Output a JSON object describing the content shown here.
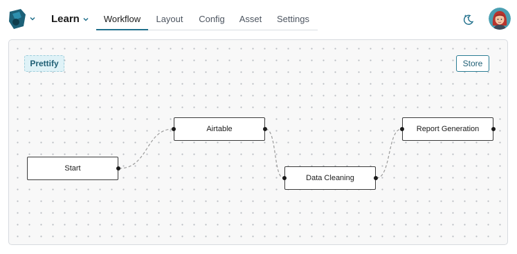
{
  "header": {
    "project_name": "Learn",
    "tabs": [
      {
        "label": "Workflow",
        "active": true
      },
      {
        "label": "Layout",
        "active": false
      },
      {
        "label": "Config",
        "active": false
      },
      {
        "label": "Asset",
        "active": false
      },
      {
        "label": "Settings",
        "active": false
      }
    ],
    "icons": {
      "logo": "app-logo-icon",
      "theme": "moon-sparkle-icon",
      "avatar": "user-avatar"
    }
  },
  "canvas": {
    "prettify_label": "Prettify",
    "store_label": "Store",
    "nodes": [
      {
        "label": "Start"
      },
      {
        "label": "Airtable"
      },
      {
        "label": "Data Cleaning"
      },
      {
        "label": "Report Generation"
      }
    ],
    "edges": [
      [
        "Start",
        "Airtable"
      ],
      [
        "Airtable",
        "Data Cleaning"
      ],
      [
        "Data Cleaning",
        "Report Generation"
      ]
    ]
  },
  "colors": {
    "accent": "#1f6f8b",
    "prettify_bg": "#dff2f7",
    "canvas_bg": "#f8f8f8"
  }
}
